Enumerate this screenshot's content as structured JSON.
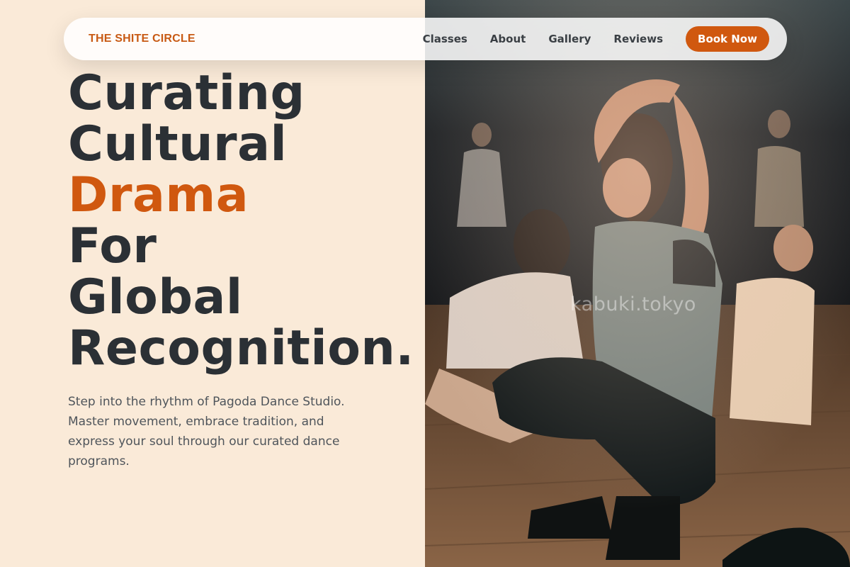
{
  "nav": {
    "brand": "THE SHITE CIRCLE",
    "links": [
      "Classes",
      "About",
      "Gallery",
      "Reviews"
    ],
    "cta_label": "Book Now"
  },
  "hero": {
    "headline_lines": [
      "Curating",
      "Cultural",
      "Drama",
      "For",
      "Global",
      "Recognition."
    ],
    "accent_word": "Drama",
    "subtext": "Step into the rhythm of Pagoda Dance Studio. Master movement, embrace tradition, and express your soul through our curated dance programs."
  },
  "image": {
    "watermark": "kabuki.tokyo"
  },
  "colors": {
    "background": "#faead8",
    "accent": "#d0580f",
    "brand": "#c85a14",
    "text_dark": "#2b3035"
  }
}
